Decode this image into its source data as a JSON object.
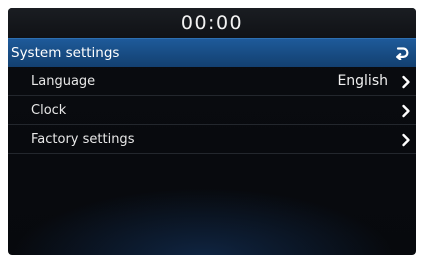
{
  "status_bar": {
    "clock": "00:00"
  },
  "header": {
    "title": "System settings",
    "back_icon": "back-arrow-icon"
  },
  "menu": {
    "items": [
      {
        "label": "Language",
        "value": "English",
        "icon": "chevron-right-icon"
      },
      {
        "label": "Clock",
        "value": "",
        "icon": "chevron-right-icon"
      },
      {
        "label": "Factory settings",
        "value": "",
        "icon": "chevron-right-icon"
      }
    ]
  },
  "colors": {
    "header_accent": "#1a5290",
    "background": "#08090c",
    "text": "#ffffff"
  }
}
